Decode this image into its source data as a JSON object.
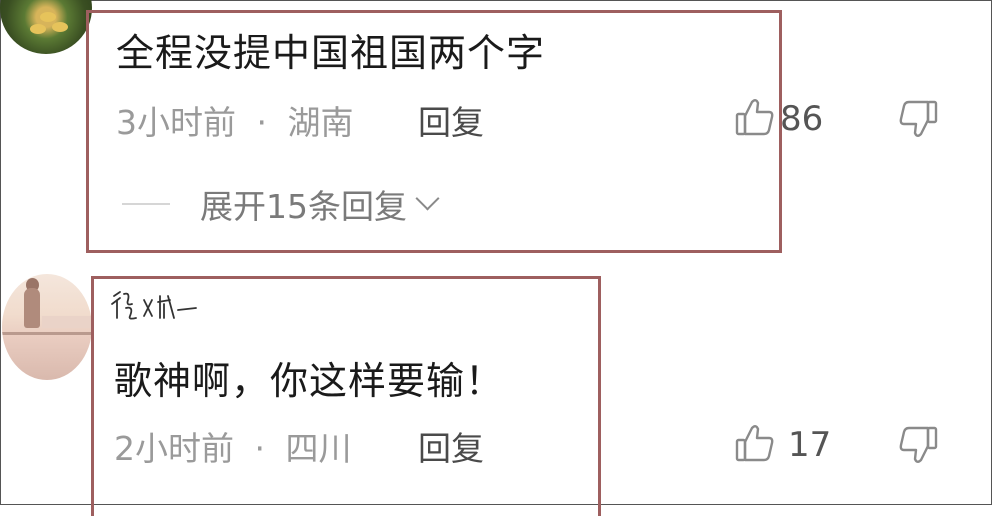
{
  "comments": [
    {
      "text": "全程没提中国祖国两个字",
      "time": "3小时前",
      "separator": "·",
      "location": "湖南",
      "reply_label": "回复",
      "expand_label": "展开15条回复",
      "like_count": "86"
    },
    {
      "username": "复写",
      "text": "歌神啊，你这样要输！",
      "time": "2小时前",
      "separator": "·",
      "location": "四川",
      "reply_label": "回复",
      "like_count": "17"
    }
  ],
  "colors": {
    "highlight_box": "#9e5f5f",
    "meta_text": "#9a9a9a",
    "body_text": "#1a1a1a"
  },
  "icons": {
    "like": "thumbs-up-icon",
    "dislike": "thumbs-down-icon",
    "expand": "chevron-down-icon"
  }
}
